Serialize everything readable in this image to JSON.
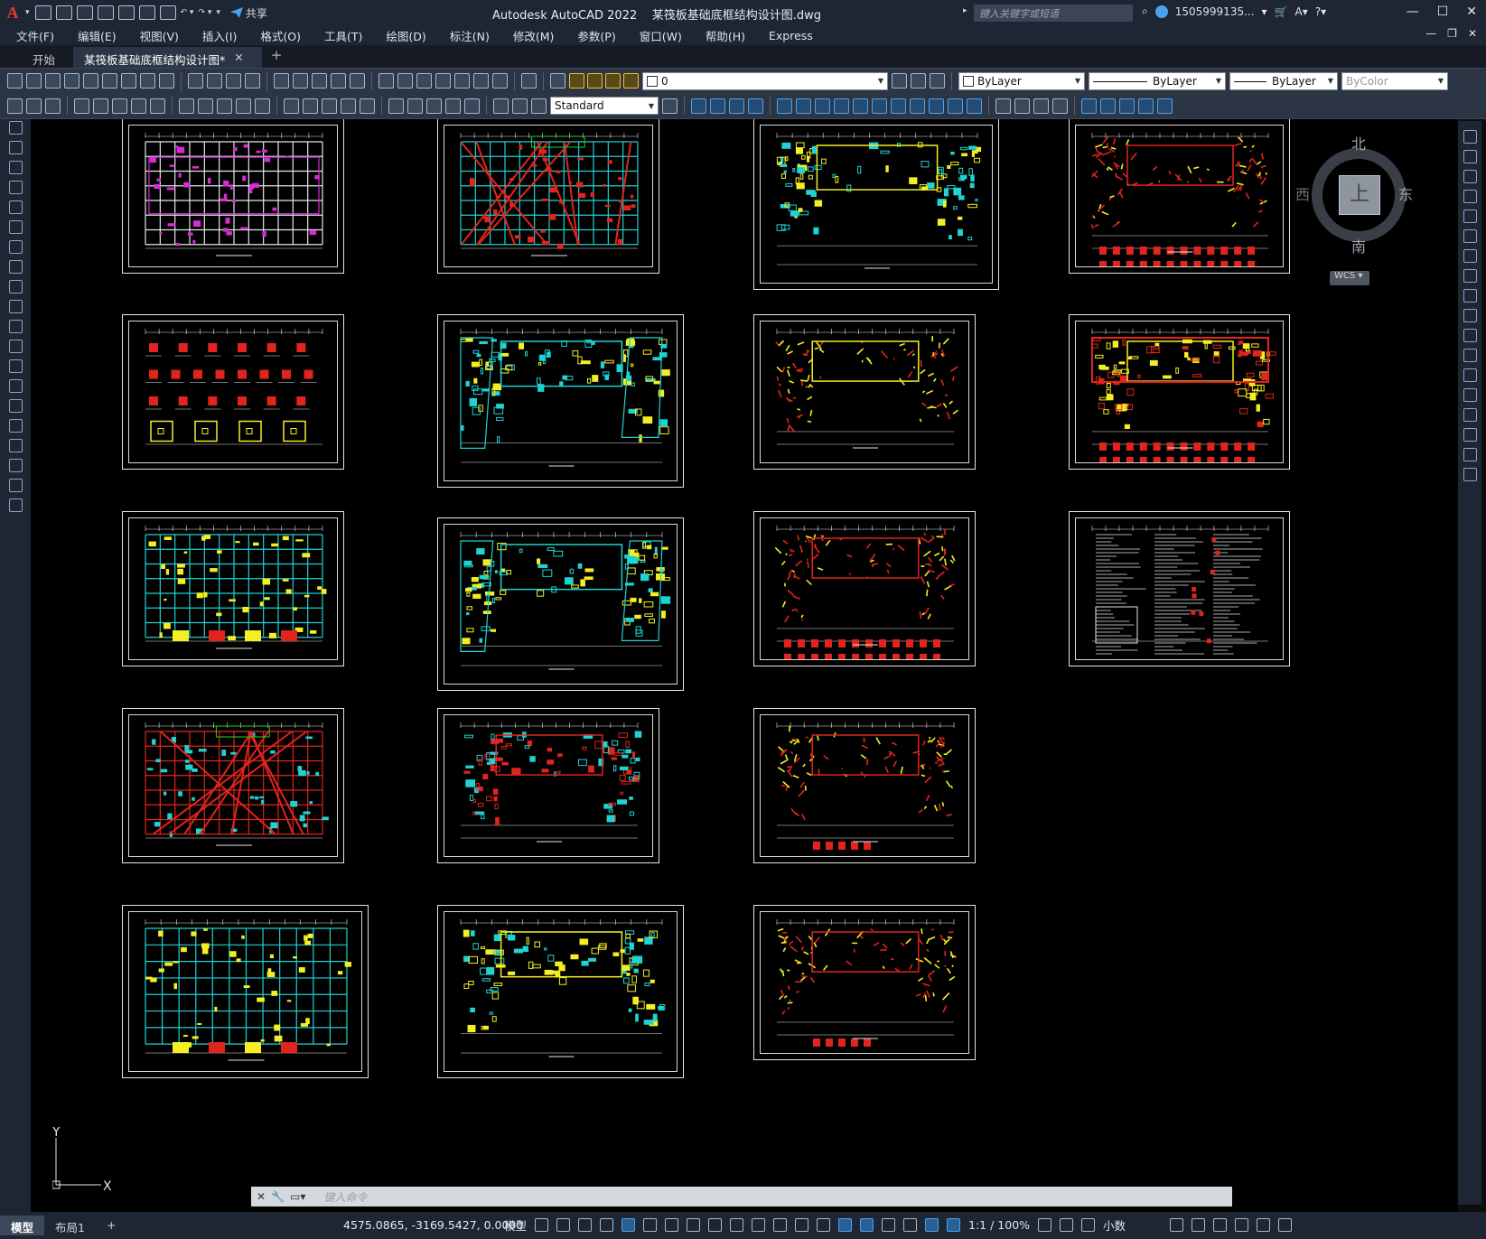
{
  "app": {
    "title": "Autodesk AutoCAD 2022",
    "filename": "某筏板基础底框结构设计图.dwg",
    "share": "共享",
    "search_placeholder": "键入关键字或短语",
    "user": "1505999135..."
  },
  "menu": [
    "文件(F)",
    "编辑(E)",
    "视图(V)",
    "插入(I)",
    "格式(O)",
    "工具(T)",
    "绘图(D)",
    "标注(N)",
    "修改(M)",
    "参数(P)",
    "窗口(W)",
    "帮助(H)",
    "Express"
  ],
  "tabs": {
    "start": "开始",
    "doc": "某筏板基础底框结构设计图*"
  },
  "toolbar": {
    "layer": "0",
    "color": "ByLayer",
    "linetype": "ByLayer",
    "lineweight": "ByLayer",
    "plotstyle": "ByColor",
    "textstyle": "Standard"
  },
  "viewcube": {
    "north": "北",
    "south": "南",
    "east": "东",
    "west": "西",
    "top": "上",
    "wcs": "WCS"
  },
  "ucs": {
    "x": "X",
    "y": "Y"
  },
  "command": {
    "placeholder": "键入命令"
  },
  "status": {
    "model_tab": "模型",
    "layout_tab": "布局1",
    "coords": "4575.0865, -3169.5427, 0.0000",
    "model": "模型",
    "scale": "1:1 / 100%",
    "units": "小数"
  },
  "colors": {
    "cyan": "#1fd3d3",
    "yellow": "#f5ef22",
    "red": "#e1241c",
    "green": "#2ad02a",
    "magenta": "#d72bd7",
    "white": "#e6e6e6"
  },
  "sheets": [
    {
      "style": "grid_magenta"
    },
    {
      "style": "grid_cyan_red"
    },
    {
      "style": "plan_yellow_cyan"
    },
    {
      "style": "red_beams_details"
    },
    {
      "style": "details"
    },
    {
      "style": "plan_cyan_yellow"
    },
    {
      "style": "plan_mix"
    },
    {
      "style": "yellow_red_plan"
    },
    {
      "style": "grid_cyan_yellow"
    },
    {
      "style": "plan_cyan_yellow"
    },
    {
      "style": "red_beams_details"
    },
    {
      "style": "notes"
    },
    {
      "style": "grid_red_cyan"
    },
    {
      "style": "plan_red_small"
    },
    {
      "style": "red_beams_small"
    },
    {
      "style": "grid_cyan_yellow"
    },
    {
      "style": "plan_yellow_cyan"
    },
    {
      "style": "red_beams_small"
    }
  ]
}
